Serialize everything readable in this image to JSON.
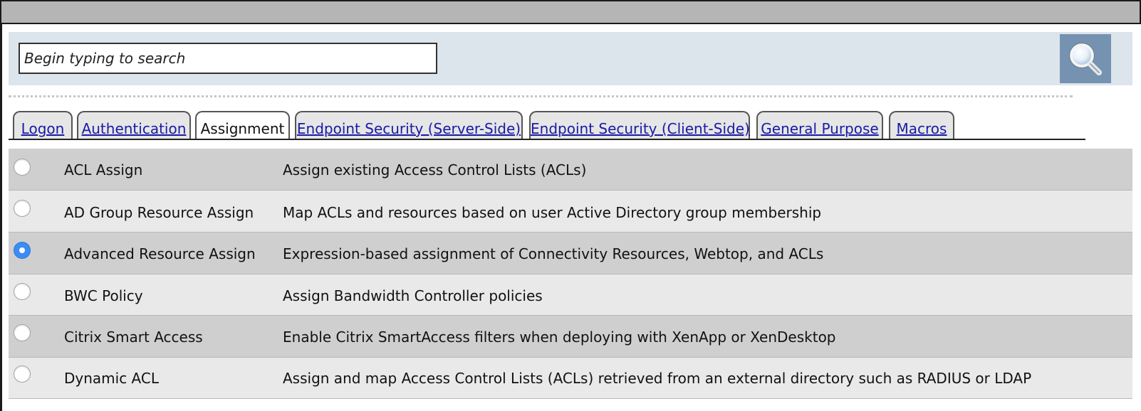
{
  "search": {
    "placeholder": "Begin typing to search"
  },
  "tabs": [
    {
      "label": "Logon",
      "active": false
    },
    {
      "label": "Authentication",
      "active": false
    },
    {
      "label": "Assignment",
      "active": true
    },
    {
      "label": "Endpoint Security (Server-Side)",
      "active": false
    },
    {
      "label": "Endpoint Security (Client-Side)",
      "active": false
    },
    {
      "label": "General Purpose",
      "active": false
    },
    {
      "label": "Macros",
      "active": false
    }
  ],
  "items": [
    {
      "name": "ACL Assign",
      "description": "Assign existing Access Control Lists (ACLs)",
      "selected": false
    },
    {
      "name": "AD Group Resource Assign",
      "description": "Map ACLs and resources based on user Active Directory group membership",
      "selected": false
    },
    {
      "name": "Advanced Resource Assign",
      "description": "Expression-based assignment of Connectivity Resources, Webtop, and ACLs",
      "selected": true
    },
    {
      "name": "BWC Policy",
      "description": "Assign Bandwidth Controller policies",
      "selected": false
    },
    {
      "name": "Citrix Smart Access",
      "description": "Enable Citrix SmartAccess filters when deploying with XenApp or XenDesktop",
      "selected": false
    },
    {
      "name": "Dynamic ACL",
      "description": "Assign and map Access Control Lists (ACLs) retrieved from an external directory such as RADIUS or LDAP",
      "selected": false
    }
  ],
  "icons": {
    "search_button": "magnifier-icon"
  },
  "colors": {
    "search_panel": "#dce4ec",
    "search_button": "#7593b1",
    "row_dark": "#cfcfcf",
    "row_light": "#e9e9e9",
    "tab_link": "#1a1aa6",
    "radio_selected": "#3b8df4"
  }
}
